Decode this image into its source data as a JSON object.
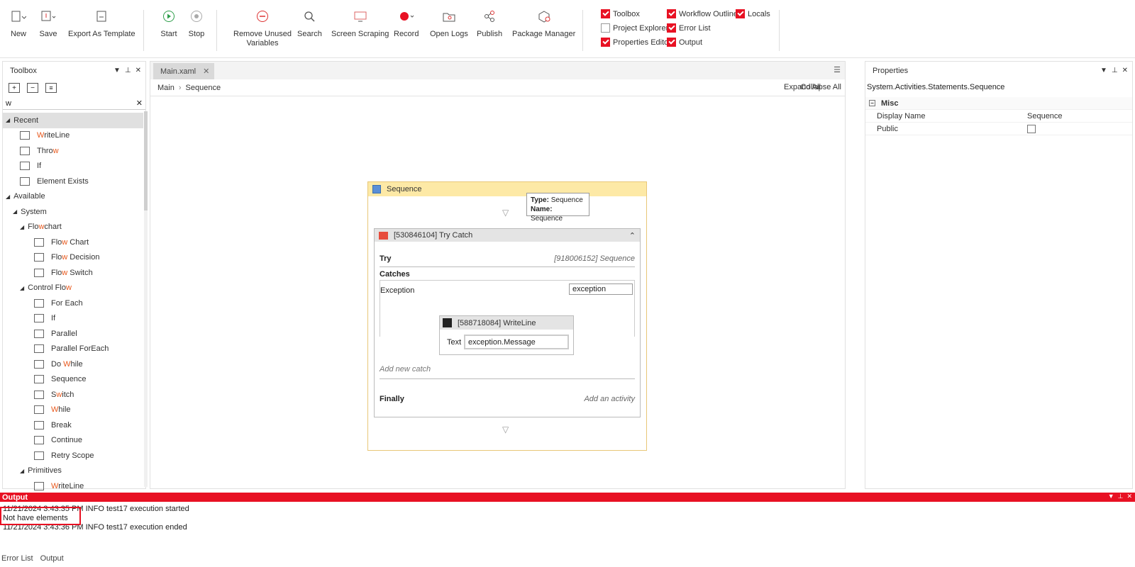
{
  "ribbon": {
    "buttons": [
      {
        "label": "New"
      },
      {
        "label": "Save"
      },
      {
        "label": "Export As Template"
      },
      {
        "label": "Start"
      },
      {
        "label": "Stop"
      },
      {
        "label": "Remove Unused\nVariables"
      },
      {
        "label": "Search"
      },
      {
        "label": "Screen Scraping"
      },
      {
        "label": "Record"
      },
      {
        "label": "Open Logs"
      },
      {
        "label": "Publish"
      },
      {
        "label": "Package Manager"
      }
    ],
    "checks": [
      {
        "label": "Toolbox",
        "checked": true
      },
      {
        "label": "Workflow Outline",
        "checked": true
      },
      {
        "label": "Locals",
        "checked": true
      },
      {
        "label": "Project Explorer",
        "checked": false
      },
      {
        "label": "Error List",
        "checked": true
      },
      {
        "label": "Properties Editor",
        "checked": true
      },
      {
        "label": "Output",
        "checked": true
      }
    ]
  },
  "toolbox": {
    "title": "Toolbox",
    "search_value": "w",
    "items": [
      {
        "label": "Recent",
        "level": 0,
        "group": true
      },
      {
        "label": "WriteLine",
        "level": 2
      },
      {
        "label": "Throw",
        "level": 2
      },
      {
        "label": "If",
        "level": 2
      },
      {
        "label": "Element Exists",
        "level": 2
      },
      {
        "label": "Available",
        "level": 0,
        "group": true
      },
      {
        "label": "System",
        "level": 1,
        "group": true
      },
      {
        "label": "Flowchart",
        "level": 2,
        "group": true
      },
      {
        "label": "Flow Chart",
        "level": 3
      },
      {
        "label": "Flow Decision",
        "level": 3
      },
      {
        "label": "Flow Switch",
        "level": 3
      },
      {
        "label": "Control Flow",
        "level": 2,
        "group": true
      },
      {
        "label": "For Each",
        "level": 3
      },
      {
        "label": "If",
        "level": 3
      },
      {
        "label": "Parallel",
        "level": 3
      },
      {
        "label": "Parallel ForEach",
        "level": 3
      },
      {
        "label": "Do While",
        "level": 3
      },
      {
        "label": "Sequence",
        "level": 3
      },
      {
        "label": "Switch",
        "level": 3
      },
      {
        "label": "While",
        "level": 3
      },
      {
        "label": "Break",
        "level": 3
      },
      {
        "label": "Continue",
        "level": 3
      },
      {
        "label": "Retry Scope",
        "level": 3
      },
      {
        "label": "Primitives",
        "level": 2,
        "group": true
      },
      {
        "label": "WriteLine",
        "level": 3
      }
    ]
  },
  "editor": {
    "tab": "Main.xaml",
    "breadcrumb": [
      "Main",
      "Sequence"
    ],
    "expand_all": "Expand All",
    "collapse_all": "Collapse All",
    "sequence_title": "Sequence",
    "tooltip": {
      "type_label": "Type:",
      "type_value": "Sequence",
      "name_label": "Name:",
      "name_value": "Sequence"
    },
    "trycatch_title": "[530846104] Try Catch",
    "try_label": "Try",
    "try_value": "[918006152] Sequence",
    "catches_label": "Catches",
    "exception_label": "Exception",
    "exception_var": "exception",
    "writeline_title": "[588718084] WriteLine",
    "text_label": "Text",
    "text_value": "exception.Message",
    "add_catch": "Add new catch",
    "finally_label": "Finally",
    "add_activity": "Add an activity"
  },
  "properties": {
    "title": "Properties",
    "type_path": "System.Activities.Statements.Sequence",
    "category": "Misc",
    "rows": [
      {
        "name": "Display Name",
        "value": "Sequence"
      },
      {
        "name": "Public",
        "value": ""
      }
    ]
  },
  "output": {
    "title": "Output",
    "lines": [
      "11/21/2024 3:43:35 PM INFO test17 execution started",
      "Not have elements",
      "11/21/2024 3:43:36 PM INFO test17 execution ended"
    ]
  },
  "bottom_tabs": [
    "Error List",
    "Output"
  ]
}
